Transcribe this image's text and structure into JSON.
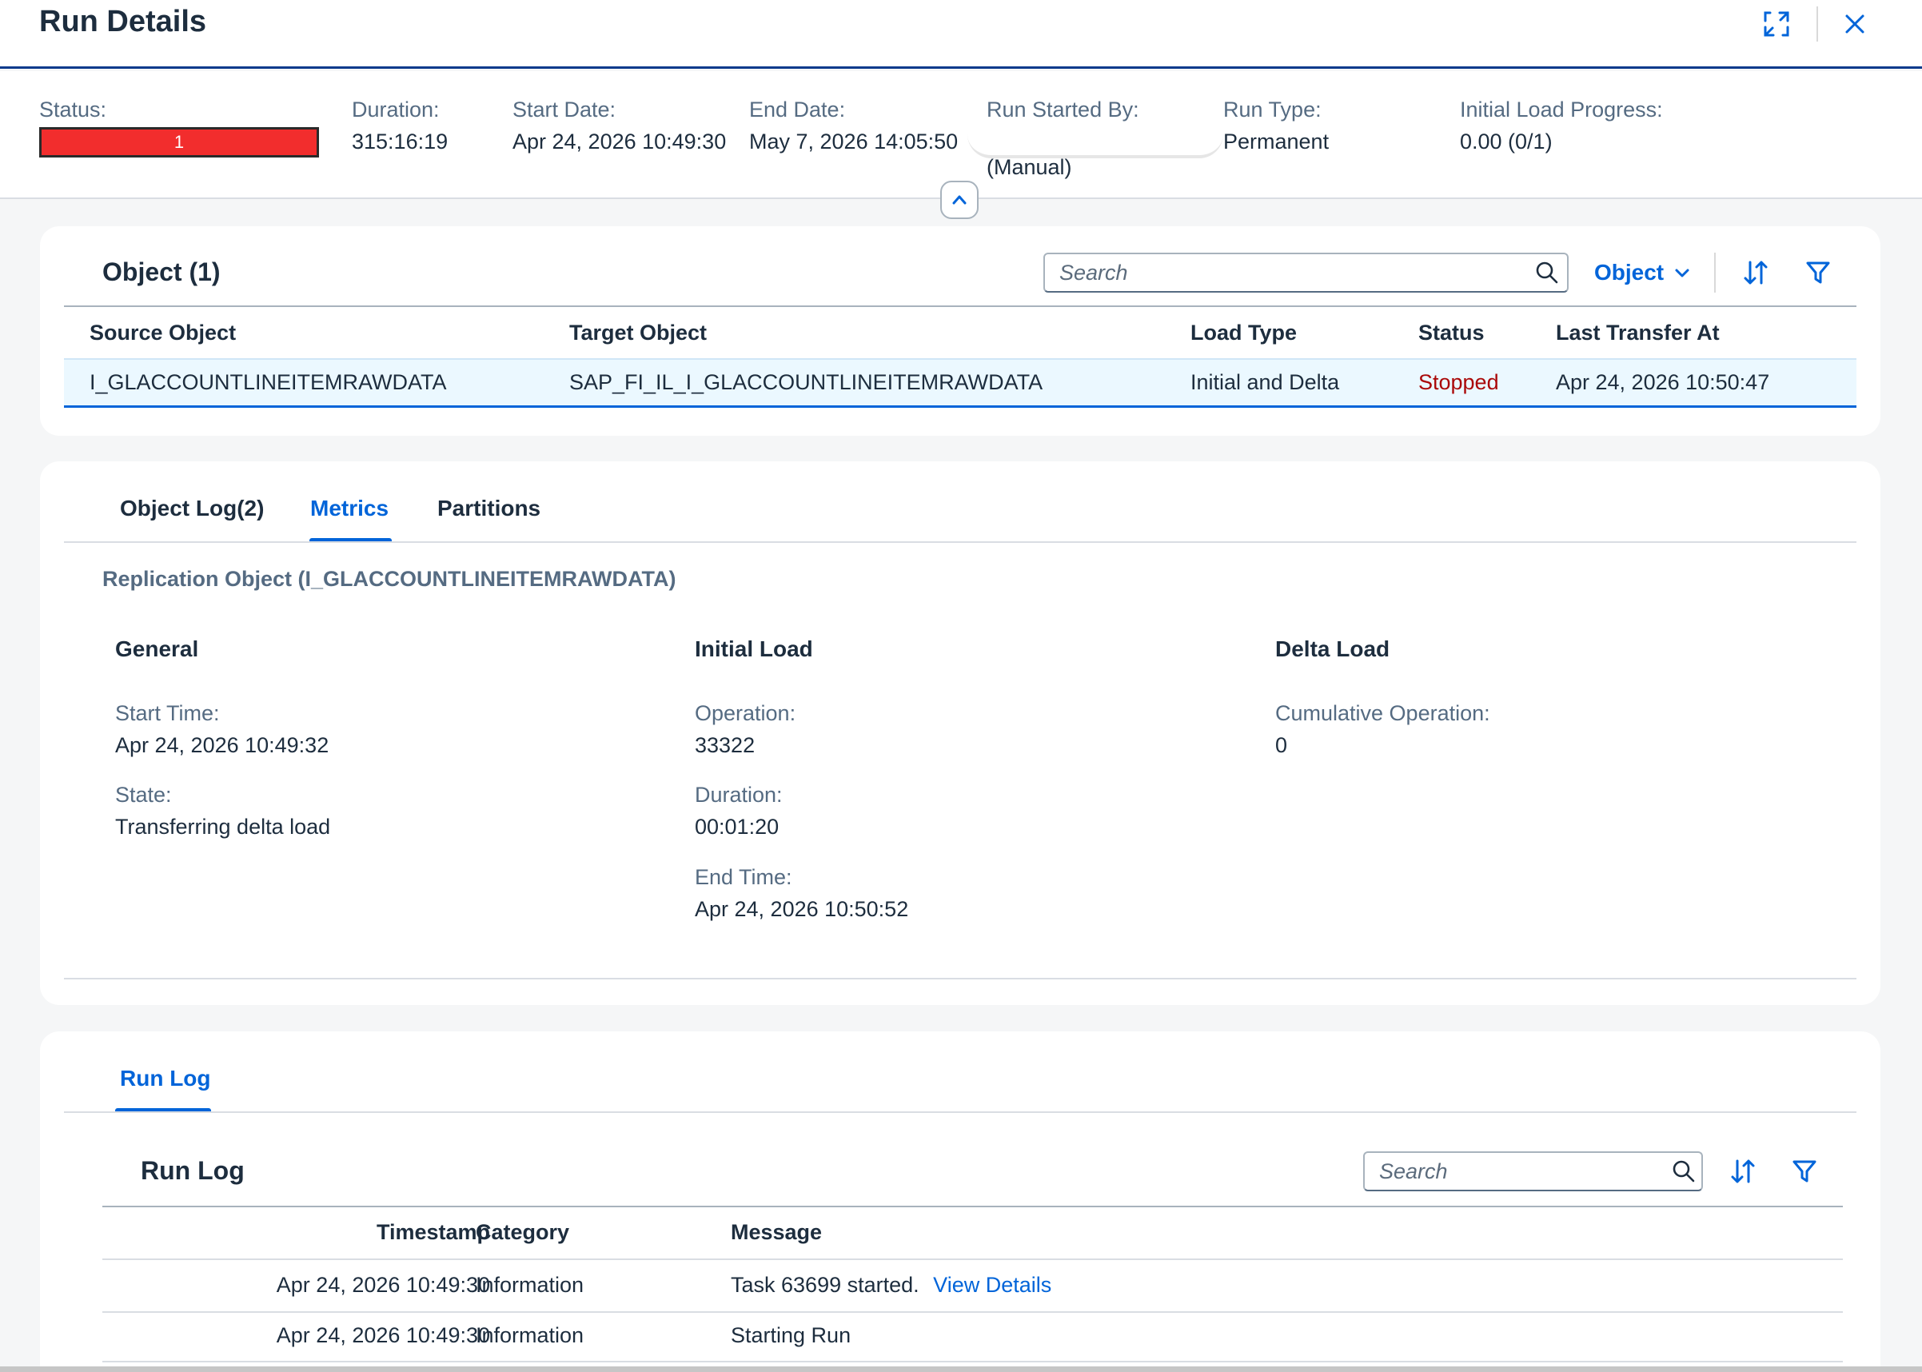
{
  "header": {
    "title": "Run Details",
    "expand_icon": "expand-icon",
    "close_icon": "close-icon"
  },
  "summary": {
    "status_label": "Status:",
    "status_value": "1",
    "status_color": "#f22d2d",
    "duration_label": "Duration:",
    "duration_value": "315:16:19",
    "start_label": "Start Date:",
    "start_value": "Apr 24, 2026 10:49:30",
    "end_label": "End Date:",
    "end_value": "May 7, 2026 14:05:50",
    "started_by_label": "Run Started By:",
    "started_by_value": "(Manual)",
    "run_type_label": "Run Type:",
    "run_type_value": "Permanent",
    "progress_label": "Initial Load Progress:",
    "progress_value": "0.00 (0/1)"
  },
  "objects": {
    "title": "Object (1)",
    "search_placeholder": "Search",
    "filter_select": "Object",
    "columns": [
      "Source Object",
      "Target Object",
      "Load Type",
      "Status",
      "Last Transfer At"
    ],
    "rows": [
      {
        "source": "I_GLACCOUNTLINEITEMRAWDATA",
        "target": "SAP_FI_IL_I_GLACCOUNTLINEITEMRAWDATA",
        "load_type": "Initial and Delta",
        "status": "Stopped",
        "status_color": "#aa0808",
        "last_transfer": "Apr 24, 2026 10:50:47"
      }
    ]
  },
  "details": {
    "tabs": [
      "Object Log(2)",
      "Metrics",
      "Partitions"
    ],
    "active_tab": "Metrics",
    "section_title": "Replication Object (I_GLACCOUNTLINEITEMRAWDATA)",
    "general": {
      "title": "General",
      "start_time_label": "Start Time:",
      "start_time_value": "Apr 24, 2026 10:49:32",
      "state_label": "State:",
      "state_value": "Transferring delta load"
    },
    "initial_load": {
      "title": "Initial Load",
      "operation_label": "Operation:",
      "operation_value": "33322",
      "duration_label": "Duration:",
      "duration_value": "00:01:20",
      "end_time_label": "End Time:",
      "end_time_value": "Apr 24, 2026 10:50:52"
    },
    "delta_load": {
      "title": "Delta Load",
      "cumulative_label": "Cumulative Operation:",
      "cumulative_value": "0"
    }
  },
  "runlog": {
    "tab": "Run Log",
    "title": "Run Log",
    "search_placeholder": "Search",
    "columns": [
      "Timestamp",
      "Category",
      "Message"
    ],
    "rows": [
      {
        "timestamp": "Apr 24, 2026 10:49:30",
        "category": "Information",
        "message": "Task 63699 started.",
        "link": "View Details"
      },
      {
        "timestamp": "Apr 24, 2026 10:49:30",
        "category": "Information",
        "message": "Starting Run",
        "link": ""
      }
    ]
  },
  "colors": {
    "accent": "#0064d9",
    "header_border": "#0a3a8c",
    "error_text": "#aa0808"
  }
}
